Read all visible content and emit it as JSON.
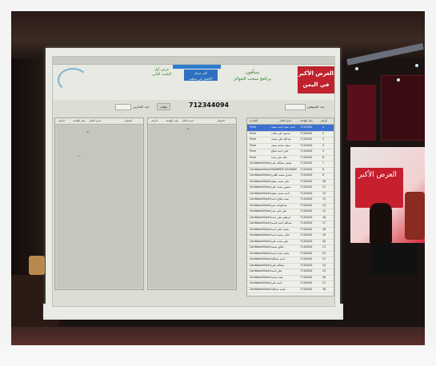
{
  "app": {
    "brand_line1": "العرض الأكبر",
    "brand_line2": "في اليمن",
    "title_line1": "سبأفون",
    "title_line2": "برنامج سحب الجوائز",
    "sponsor_line1": "عرض أول",
    "sponsor_line2": "المليث الثاني",
    "badge_line1": "أكثر شبكة",
    "badge_line2": "الأفضل في تغطية"
  },
  "toolbar": {
    "count_label": "عدد المتوفين",
    "winners_label": "عدد الفائزين",
    "stop_button": "توقف",
    "current_number": "712344094"
  },
  "panels": {
    "left_headers": [
      "الرقم",
      "رقم الهاتف",
      "اسم الفائز",
      "الجوائز"
    ],
    "mid_headers": [
      "الرقم",
      "رقم الهاتف",
      "اسم الفائز",
      "الجوائز"
    ]
  },
  "list": {
    "headers": [
      "الرقم",
      "رقم الهاتف",
      "اسم الفائز",
      "الجائزة"
    ],
    "rows": [
      {
        "n": "1",
        "phone": "711XXXX",
        "name": "احمد عبده احمد سيف",
        "prize": "Prize"
      },
      {
        "n": "2",
        "phone": "711XXXX",
        "name": "محمود علي غالب",
        "prize": "Prize"
      },
      {
        "n": "3",
        "phone": "711XXXX",
        "name": "عبدالله علي محمد",
        "prize": "Prize"
      },
      {
        "n": "4",
        "phone": "711XXXX",
        "name": "سعيد محمد سيف",
        "prize": "Prize"
      },
      {
        "n": "5",
        "phone": "711XXXX",
        "name": "علي احمد صالح",
        "prize": "Prize"
      },
      {
        "n": "6",
        "phone": "711XXXX",
        "name": "خالد علي عبده",
        "prize": "Prize"
      },
      {
        "n": "7",
        "phone": "711XXXX",
        "name": "فيصل عبدالله علي",
        "prize": "CaribbeanSmart"
      },
      {
        "n": "8",
        "phone": "711XXXX",
        "name": "YASMEEN SOLIMAN",
        "prize": "CaribbeanSmart"
      },
      {
        "n": "9",
        "phone": "711XXXX",
        "name": "مجدي محمد الغابي",
        "prize": "CaribbeanSmart"
      },
      {
        "n": "10",
        "phone": "711XXXX",
        "name": "علي محمد مقبل",
        "prize": "CaribbeanSmart"
      },
      {
        "n": "11",
        "phone": "711XXXX",
        "name": "منصور محمد علي",
        "prize": "CaribbeanSmart"
      },
      {
        "n": "12",
        "phone": "711XXXX",
        "name": "احمد محمد مقبل",
        "prize": "CaribbeanSmart"
      },
      {
        "n": "13",
        "phone": "711XXXX",
        "name": "عبده صالح احمد",
        "prize": "CaribbeanSmart"
      },
      {
        "n": "14",
        "phone": "711XXXX",
        "name": "عبدالواحد عمر",
        "prize": "CaribbeanSmart"
      },
      {
        "n": "15",
        "phone": "711XXXX",
        "name": "علي علي عمر",
        "prize": "CaribbeanSmart"
      },
      {
        "n": "16",
        "phone": "711XXXX",
        "name": "ابراهيم علي عبده",
        "prize": "CaribbeanSmart"
      },
      {
        "n": "17",
        "phone": "711XXXX",
        "name": "عبدالله احمد قاسم",
        "prize": "CaribbeanSmart"
      },
      {
        "n": "18",
        "phone": "711XXXX",
        "name": "محمد علي احمد",
        "prize": "CaribbeanSmart"
      },
      {
        "n": "19",
        "phone": "711XXXX",
        "name": "عادل محمد احمد",
        "prize": "CaribbeanSmart"
      },
      {
        "n": "20",
        "phone": "711XXXX",
        "name": "علي محمد علي",
        "prize": "CaribbeanSmart"
      },
      {
        "n": "21",
        "phone": "711XXXX",
        "name": "صالح محمد",
        "prize": "CaribbeanSmart"
      },
      {
        "n": "22",
        "phone": "711XXXX",
        "name": "محمد عبده احمد",
        "prize": "CaribbeanSmart"
      },
      {
        "n": "23",
        "phone": "711XXXX",
        "name": "احمد عبدالله",
        "prize": "CaribbeanSmart"
      },
      {
        "n": "24",
        "phone": "711XXXX",
        "name": "عبدالله علي",
        "prize": "CaribbeanSmart"
      },
      {
        "n": "25",
        "phone": "711XXXX",
        "name": "علي احمد",
        "prize": "CaribbeanSmart"
      },
      {
        "n": "26",
        "phone": "711XXXX",
        "name": "عبده محمد",
        "prize": "CaribbeanSmart"
      },
      {
        "n": "27",
        "phone": "711XXXX",
        "name": "احمد علي",
        "prize": "CaribbeanSmart"
      },
      {
        "n": "28",
        "phone": "711XXXX",
        "name": "محمد عبدالله",
        "prize": "CaribbeanSmart"
      }
    ]
  },
  "scene": {
    "banner_text": "العرض الأكبر"
  }
}
